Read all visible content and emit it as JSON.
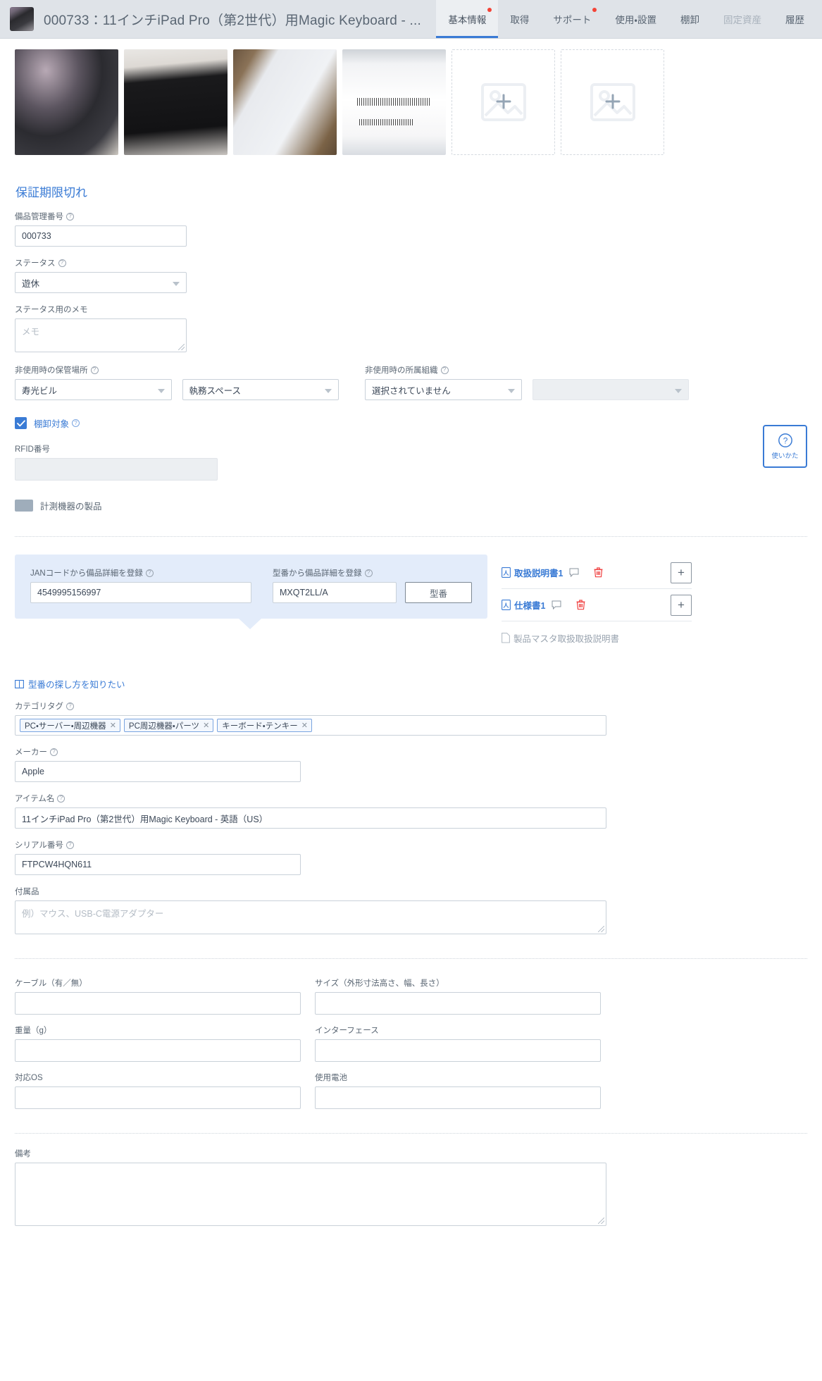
{
  "header": {
    "avatar_name": "item-thumbnail",
    "title": "000733：11インチiPad Pro（第2世代）用Magic Keyboard - ...",
    "tabs": [
      {
        "label": "基本情報",
        "active": true,
        "badge": true,
        "disabled": false
      },
      {
        "label": "取得",
        "active": false,
        "badge": false,
        "disabled": false
      },
      {
        "label": "サポート",
        "active": false,
        "badge": true,
        "disabled": false
      },
      {
        "label": "使用・設置",
        "active": false,
        "badge": false,
        "disabled": false
      },
      {
        "label": "棚卸",
        "active": false,
        "badge": false,
        "disabled": false
      },
      {
        "label": "固定資産",
        "active": false,
        "badge": false,
        "disabled": true
      },
      {
        "label": "履歴",
        "active": false,
        "badge": false,
        "disabled": false
      }
    ]
  },
  "photos": {
    "count": 4,
    "add_slots": 2,
    "add_icon": "image-plus-icon"
  },
  "main": {
    "section_title": "保証期限切れ",
    "asset_number": {
      "label": "備品管理番号",
      "help": true,
      "value": "000733"
    },
    "status": {
      "label": "ステータス",
      "help": true,
      "value": "遊休"
    },
    "status_memo": {
      "label": "ステータス用のメモ",
      "help": false,
      "placeholder": "メモ",
      "value": ""
    },
    "storage_location": {
      "label": "非使用時の保管場所",
      "help": true,
      "value1": "寿光ビル",
      "value2": "執務スペース"
    },
    "org": {
      "label": "非使用時の所属組織",
      "help": true,
      "value1": "選択されていません",
      "value2": ""
    },
    "inventory_target": {
      "label": "棚卸対象",
      "help": true,
      "checked": true
    },
    "rfid": {
      "label": "RFID番号",
      "value": "",
      "readonly": true
    },
    "measuring_device": {
      "label": "計測機器の製品",
      "enabled": false
    }
  },
  "jan_panel": {
    "jan": {
      "label": "JANコードから備品詳細を登録",
      "help": true,
      "value": "4549995156997"
    },
    "model": {
      "label": "型番から備品詳細を登録",
      "help": true,
      "value": "MXQT2LL/A"
    },
    "model_button": "型番"
  },
  "docs": {
    "rows": [
      {
        "name": "取扱説明書1",
        "type": "pdf",
        "comment_icon": "comment-icon",
        "delete_icon": "trash-icon",
        "add_label": "+"
      },
      {
        "name": "仕様書1",
        "type": "pdf",
        "comment_icon": "comment-icon",
        "delete_icon": "trash-icon",
        "add_label": "+"
      },
      {
        "name": "製品マスタ取扱取扱説明書",
        "type": "file-muted"
      }
    ]
  },
  "hint_link": {
    "icon": "book-icon",
    "label": "型番の探し方を知りたい"
  },
  "details": {
    "category_tags": {
      "label": "カテゴリタグ",
      "help": true,
      "tags": [
        "PC・サーバー・周辺機器",
        "PC周辺機器・パーツ",
        "キーボード・テンキー"
      ]
    },
    "maker": {
      "label": "メーカー",
      "help": true,
      "value": "Apple"
    },
    "item_name": {
      "label": "アイテム名",
      "help": true,
      "value": "11インチiPad Pro（第2世代）用Magic Keyboard - 英語（US）"
    },
    "serial": {
      "label": "シリアル番号",
      "help": true,
      "value": "FTPCW4HQN611"
    },
    "accessories": {
      "label": "付属品",
      "placeholder": "例）マウス、USB-C電源アダプター",
      "value": ""
    }
  },
  "specs": {
    "cable": {
      "label": "ケーブル（有／無）",
      "value": ""
    },
    "size": {
      "label": "サイズ（外形寸法高さ、幅、長さ）",
      "value": ""
    },
    "weight": {
      "label": "重量（g）",
      "value": ""
    },
    "interface": {
      "label": "インターフェース",
      "value": ""
    },
    "os": {
      "label": "対応OS",
      "value": ""
    },
    "battery": {
      "label": "使用電池",
      "value": ""
    }
  },
  "remarks": {
    "label": "備考",
    "value": ""
  },
  "help_button": {
    "icon": "question-circle-icon",
    "label": "使いかた"
  },
  "colors": {
    "accent": "#3a7bd5",
    "header_bg": "#dfe3e8",
    "panel_bg": "#e3ecfa",
    "danger": "#f44336",
    "text": "#3c4858",
    "muted": "#9aa4b0"
  }
}
